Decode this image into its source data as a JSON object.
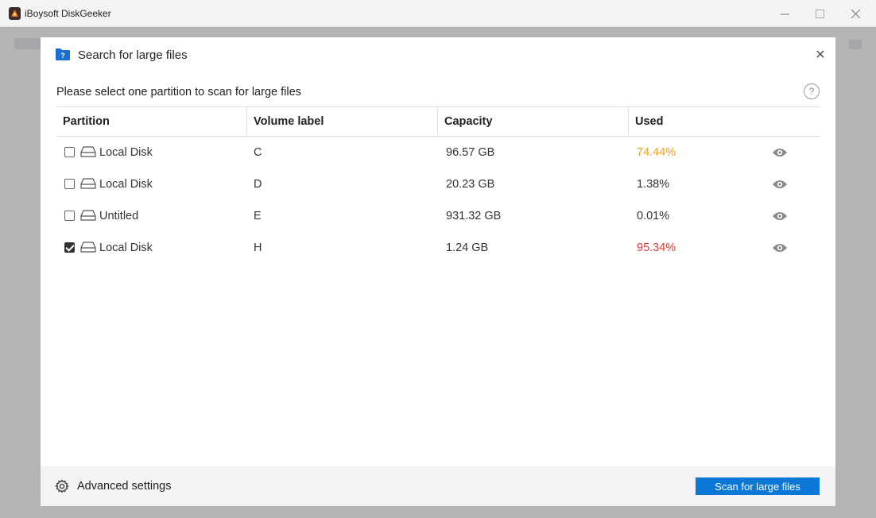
{
  "window": {
    "title": "iBoysoft DiskGeeker"
  },
  "dialog": {
    "title": "Search for large files",
    "prompt": "Please select one partition to scan for large files",
    "help_symbol": "?",
    "close_symbol": "✕"
  },
  "table": {
    "headers": [
      "Partition",
      "Volume label",
      "Capacity",
      "Used"
    ],
    "rows": [
      {
        "checked": false,
        "name": "Local Disk",
        "label": "C",
        "capacity": "96.57 GB",
        "used": "74.44%",
        "used_color": "#f0a020"
      },
      {
        "checked": false,
        "name": "Local Disk",
        "label": "D",
        "capacity": "20.23 GB",
        "used": "1.38%",
        "used_color": "#333333"
      },
      {
        "checked": false,
        "name": "Untitled",
        "label": "E",
        "capacity": "931.32 GB",
        "used": "0.01%",
        "used_color": "#333333"
      },
      {
        "checked": true,
        "name": "Local Disk",
        "label": "H",
        "capacity": "1.24 GB",
        "used": "95.34%",
        "used_color": "#e53935"
      }
    ]
  },
  "footer": {
    "advanced_label": "Advanced settings",
    "scan_label": "Scan for large files"
  },
  "colors": {
    "accent": "#0a78d4",
    "warning": "#f0a020",
    "danger": "#e53935"
  },
  "icons": {
    "app": "app-logo-icon",
    "folder": "folder-question-icon",
    "disk": "hard-disk-icon",
    "preview": "eye-icon",
    "settings": "gear-icon"
  }
}
